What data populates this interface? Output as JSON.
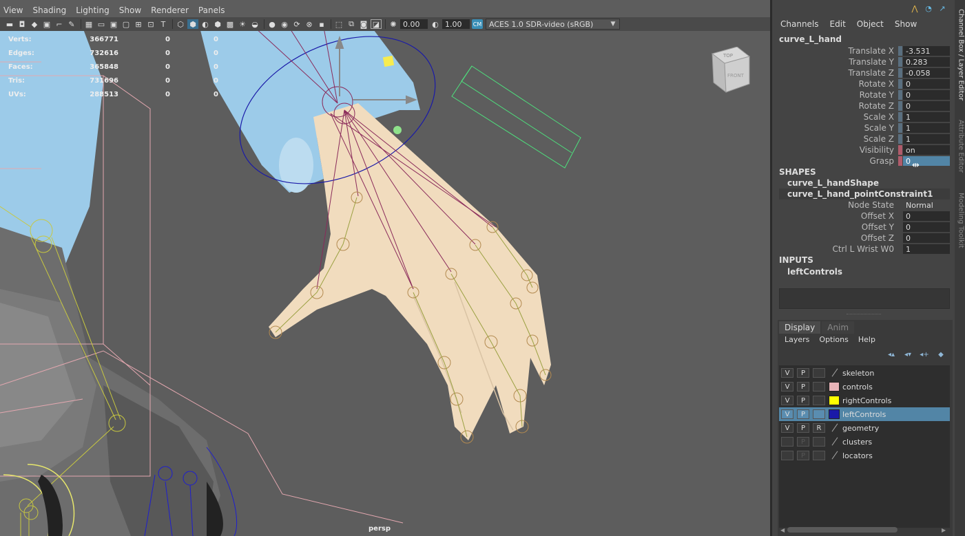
{
  "viewport": {
    "menus": [
      "View",
      "Shading",
      "Lighting",
      "Show",
      "Renderer",
      "Panels"
    ],
    "toolbar": {
      "exposure": "0.00",
      "gamma": "1.00",
      "color_space": "ACES 1.0 SDR-video (sRGB)"
    },
    "hud": [
      {
        "label": "Verts:",
        "v1": "366771",
        "v2": "0",
        "v3": "0"
      },
      {
        "label": "Edges:",
        "v1": "732616",
        "v2": "0",
        "v3": "0"
      },
      {
        "label": "Faces:",
        "v1": "365848",
        "v2": "0",
        "v3": "0"
      },
      {
        "label": "Tris:",
        "v1": "731696",
        "v2": "0",
        "v3": "0"
      },
      {
        "label": "UVs:",
        "v1": "288513",
        "v2": "0",
        "v3": "0"
      }
    ],
    "camera_label": "persp",
    "viewcube": {
      "top": "TOP",
      "front": "FRONT"
    },
    "colors": {
      "background": "#5d5d5d",
      "sleeve": "#9ccbe9",
      "skin": "#f1dcbe",
      "joint": "#8a2a5a"
    }
  },
  "channel_box": {
    "menus": [
      "Channels",
      "Edit",
      "Object",
      "Show"
    ],
    "object_name": "curve_L_hand",
    "attributes": [
      {
        "label": "Translate X",
        "value": "-3.531",
        "marker": "normal"
      },
      {
        "label": "Translate Y",
        "value": "0.283",
        "marker": "normal"
      },
      {
        "label": "Translate Z",
        "value": "-0.058",
        "marker": "normal"
      },
      {
        "label": "Rotate X",
        "value": "0",
        "marker": "normal"
      },
      {
        "label": "Rotate Y",
        "value": "0",
        "marker": "normal"
      },
      {
        "label": "Rotate Z",
        "value": "0",
        "marker": "normal"
      },
      {
        "label": "Scale X",
        "value": "1",
        "marker": "normal"
      },
      {
        "label": "Scale Y",
        "value": "1",
        "marker": "normal"
      },
      {
        "label": "Scale Z",
        "value": "1",
        "marker": "normal"
      },
      {
        "label": "Visibility",
        "value": "on",
        "marker": "red"
      },
      {
        "label": "Grasp",
        "value": "0",
        "marker": "red",
        "selected": true
      }
    ],
    "shapes_header": "SHAPES",
    "shapes": [
      "curve_L_handShape",
      "curve_L_hand_pointConstraint1"
    ],
    "constraint_attributes": [
      {
        "label": "Node State",
        "value": "Normal"
      },
      {
        "label": "Offset X",
        "value": "0"
      },
      {
        "label": "Offset Y",
        "value": "0"
      },
      {
        "label": "Offset Z",
        "value": "0"
      },
      {
        "label": "Ctrl L Wrist W0",
        "value": "1"
      }
    ],
    "inputs_header": "INPUTS",
    "inputs": [
      "leftControls"
    ]
  },
  "side_tabs": [
    "Channel Box / Layer Editor",
    "Attribute Editor",
    "Modeling Toolkit"
  ],
  "layer_editor": {
    "tabs": [
      "Display",
      "Anim"
    ],
    "menus": [
      "Layers",
      "Options",
      "Help"
    ],
    "layers": [
      {
        "v": "V",
        "p": "P",
        "r": "",
        "name": "skeleton",
        "color": "none",
        "selected": false,
        "dim": false
      },
      {
        "v": "V",
        "p": "P",
        "r": "",
        "name": "controls",
        "color": "#e8b4b8",
        "selected": false,
        "dim": false
      },
      {
        "v": "V",
        "p": "P",
        "r": "",
        "name": "rightControls",
        "color": "#ffff00",
        "selected": false,
        "dim": false
      },
      {
        "v": "V",
        "p": "P",
        "r": "",
        "name": "leftControls",
        "color": "#1a1aa8",
        "selected": true,
        "dim": false
      },
      {
        "v": "V",
        "p": "P",
        "r": "R",
        "name": "geometry",
        "color": "none",
        "selected": false,
        "dim": false
      },
      {
        "v": "",
        "p": "P",
        "r": "",
        "name": "clusters",
        "color": "none",
        "selected": false,
        "dim": true
      },
      {
        "v": "",
        "p": "P",
        "r": "",
        "name": "locators",
        "color": "none",
        "selected": false,
        "dim": true
      }
    ]
  }
}
